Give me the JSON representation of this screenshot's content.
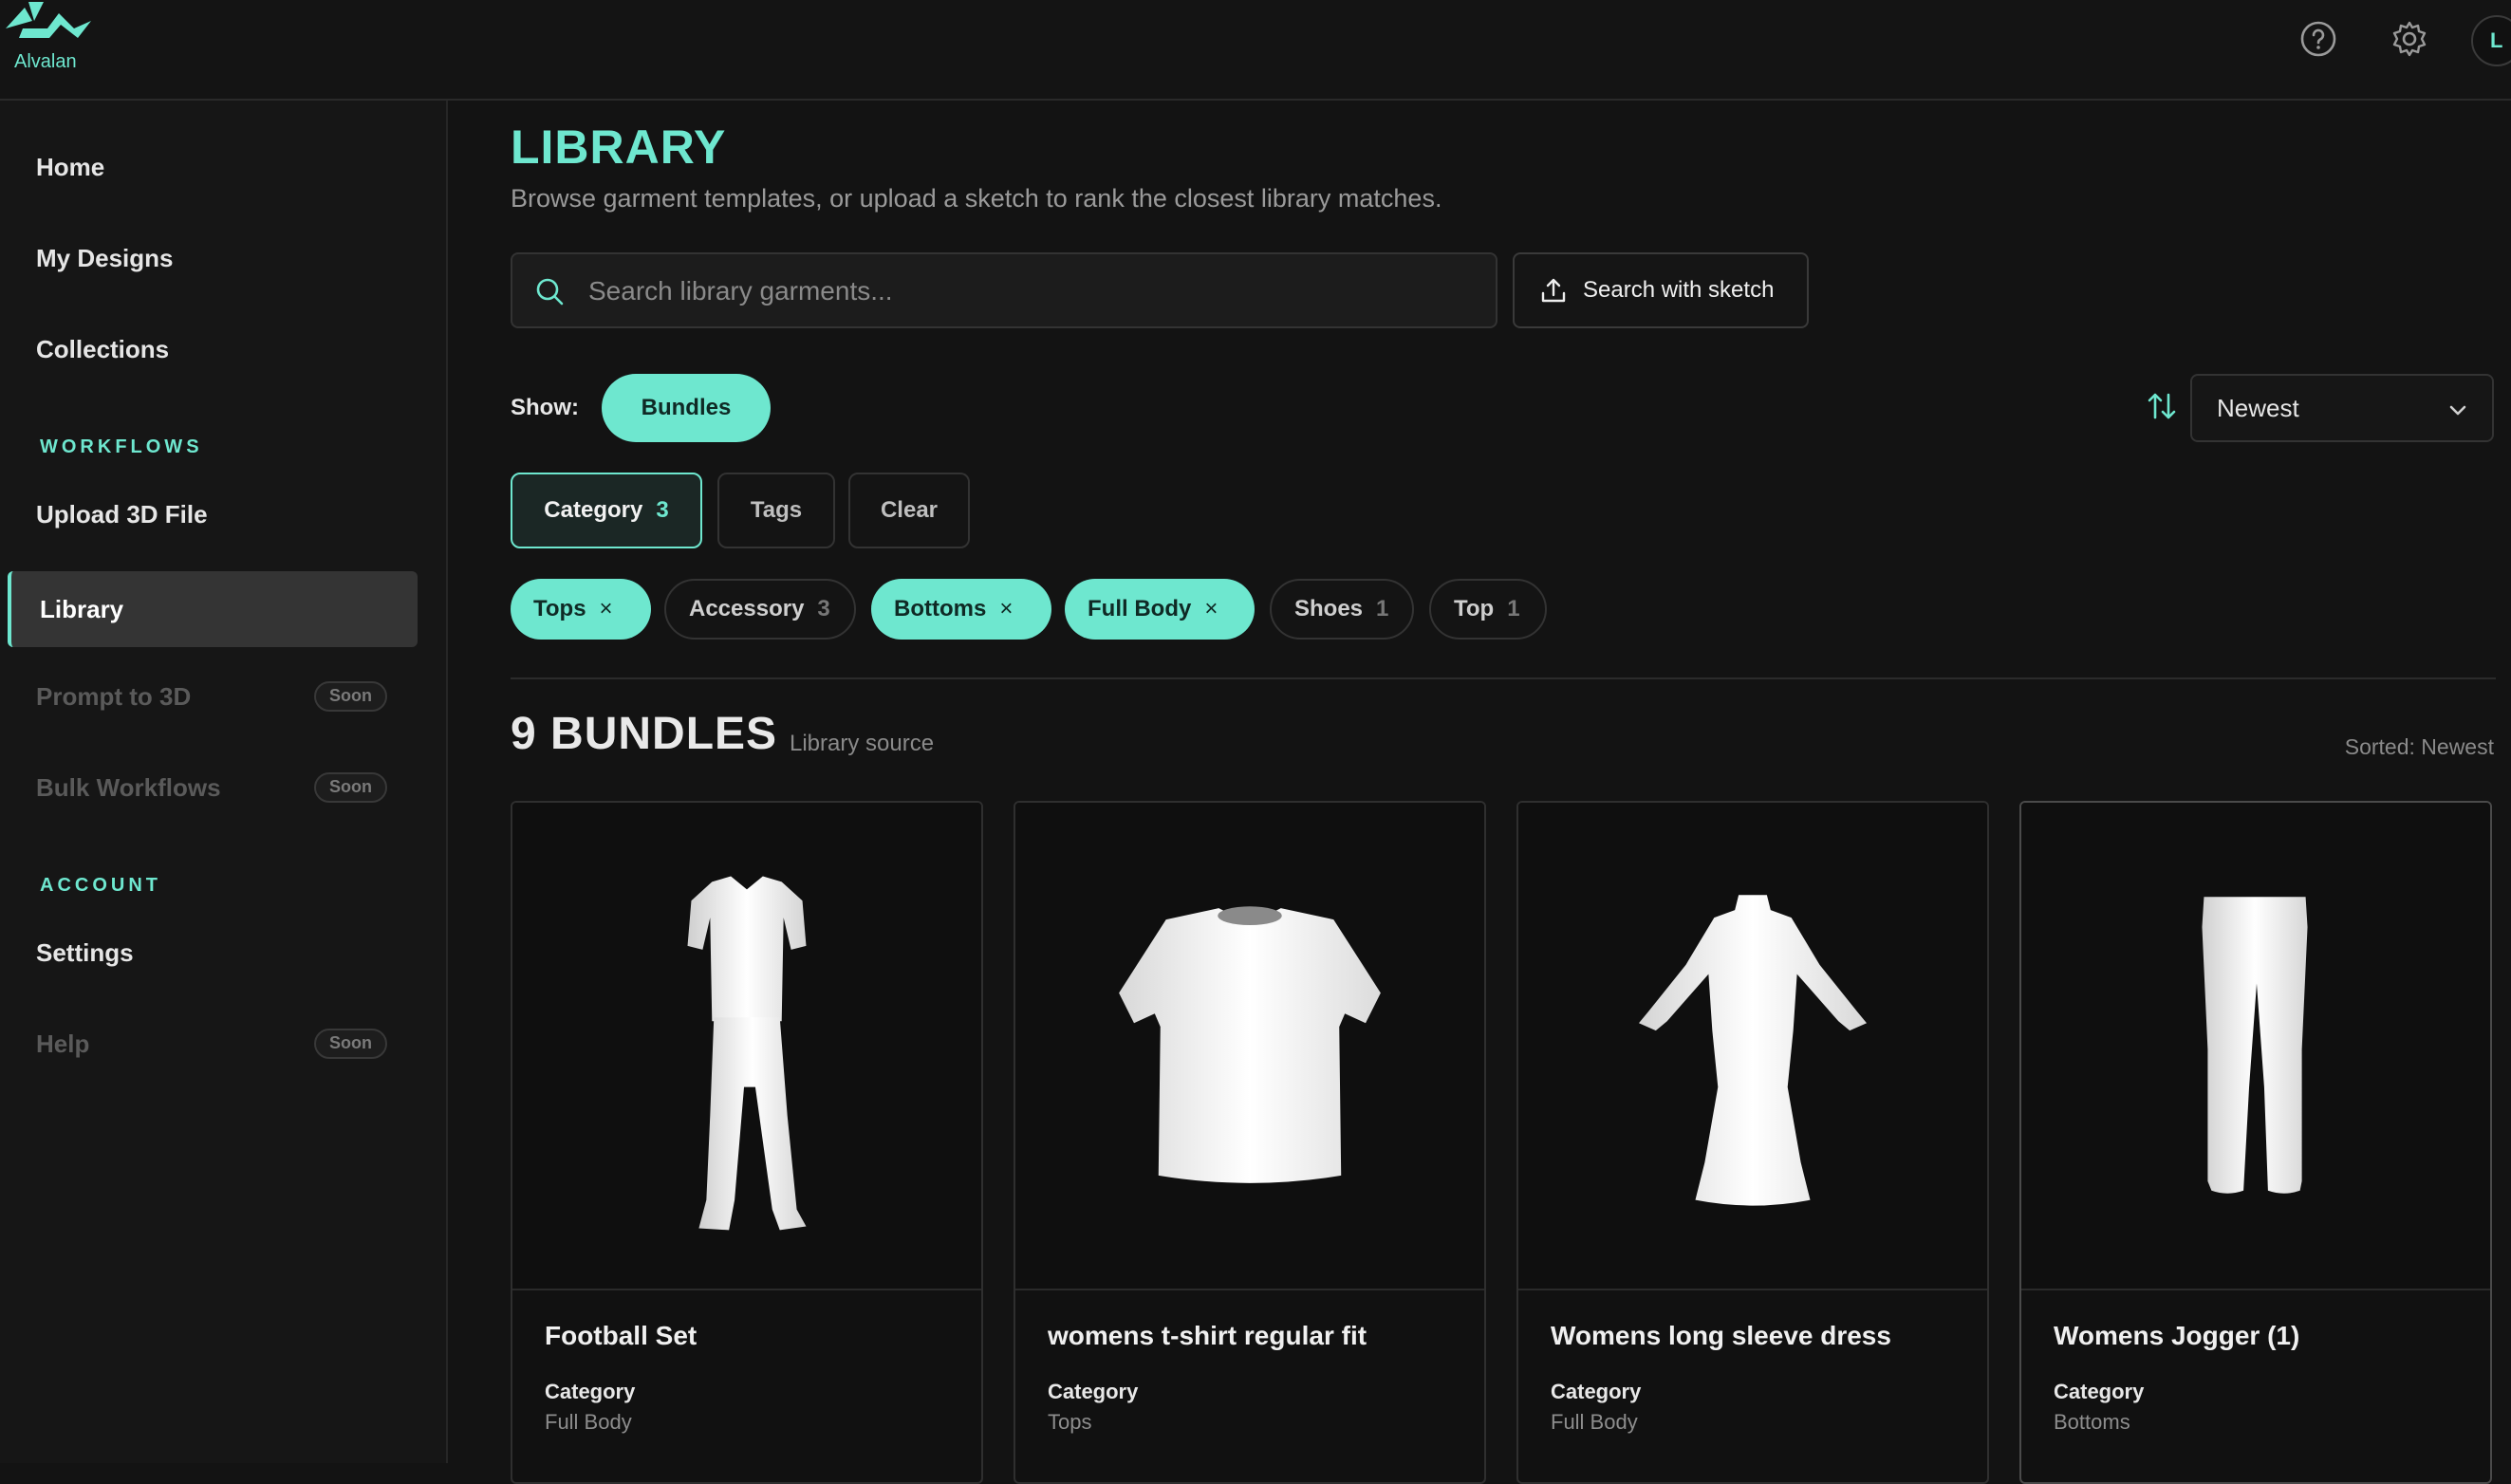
{
  "app": {
    "brand": "Alvalan",
    "avatar_initial": "L",
    "accent": "#6ee7cf"
  },
  "topbar": {
    "help_icon": "help-circle-icon",
    "settings_icon": "gear-icon"
  },
  "sidebar": {
    "items": [
      {
        "label": "Home"
      },
      {
        "label": "My Designs"
      },
      {
        "label": "Collections"
      }
    ],
    "workflows_label": "WORKFLOWS",
    "workflows": [
      {
        "label": "Upload 3D File"
      },
      {
        "label": "Library",
        "active": true
      },
      {
        "label": "Prompt to 3D",
        "badge": "Soon"
      },
      {
        "label": "Bulk Workflows",
        "badge": "Soon"
      }
    ],
    "account_label": "ACCOUNT",
    "account": [
      {
        "label": "Settings"
      },
      {
        "label": "Help",
        "badge": "Soon"
      }
    ]
  },
  "main": {
    "title": "LIBRARY",
    "subtitle": "Browse garment templates, or upload a sketch to rank the closest library matches.",
    "search": {
      "placeholder": "Search library garments...",
      "value": ""
    },
    "sketch_button": "Search with sketch",
    "show_label": "Show:",
    "show_option": "Bundles",
    "sort": {
      "selected": "Newest"
    },
    "filters": {
      "category": {
        "label": "Category",
        "count": "3"
      },
      "tags": "Tags",
      "clear": "Clear"
    },
    "chips": [
      {
        "label": "Tops",
        "selected": true,
        "x": "×"
      },
      {
        "label": "Accessory",
        "count": "3"
      },
      {
        "label": "Bottoms",
        "selected": true,
        "x": "×"
      },
      {
        "label": "Full Body",
        "selected": true,
        "x": "×"
      },
      {
        "label": "Shoes",
        "count": "1"
      },
      {
        "label": "Top",
        "count": "1"
      }
    ],
    "results": {
      "title": "9 BUNDLES",
      "source": "Library source",
      "sorted_note": "Sorted: Newest"
    },
    "cards": [
      {
        "title": "Football Set",
        "category_label": "Category",
        "category": "Full Body",
        "thumb": "football-set"
      },
      {
        "title": "womens t-shirt regular fit",
        "category_label": "Category",
        "category": "Tops",
        "thumb": "tshirt"
      },
      {
        "title": "Womens long sleeve dress",
        "category_label": "Category",
        "category": "Full Body",
        "thumb": "dress"
      },
      {
        "title": "Womens Jogger (1)",
        "category_label": "Category",
        "category": "Bottoms",
        "thumb": "jogger"
      }
    ]
  }
}
